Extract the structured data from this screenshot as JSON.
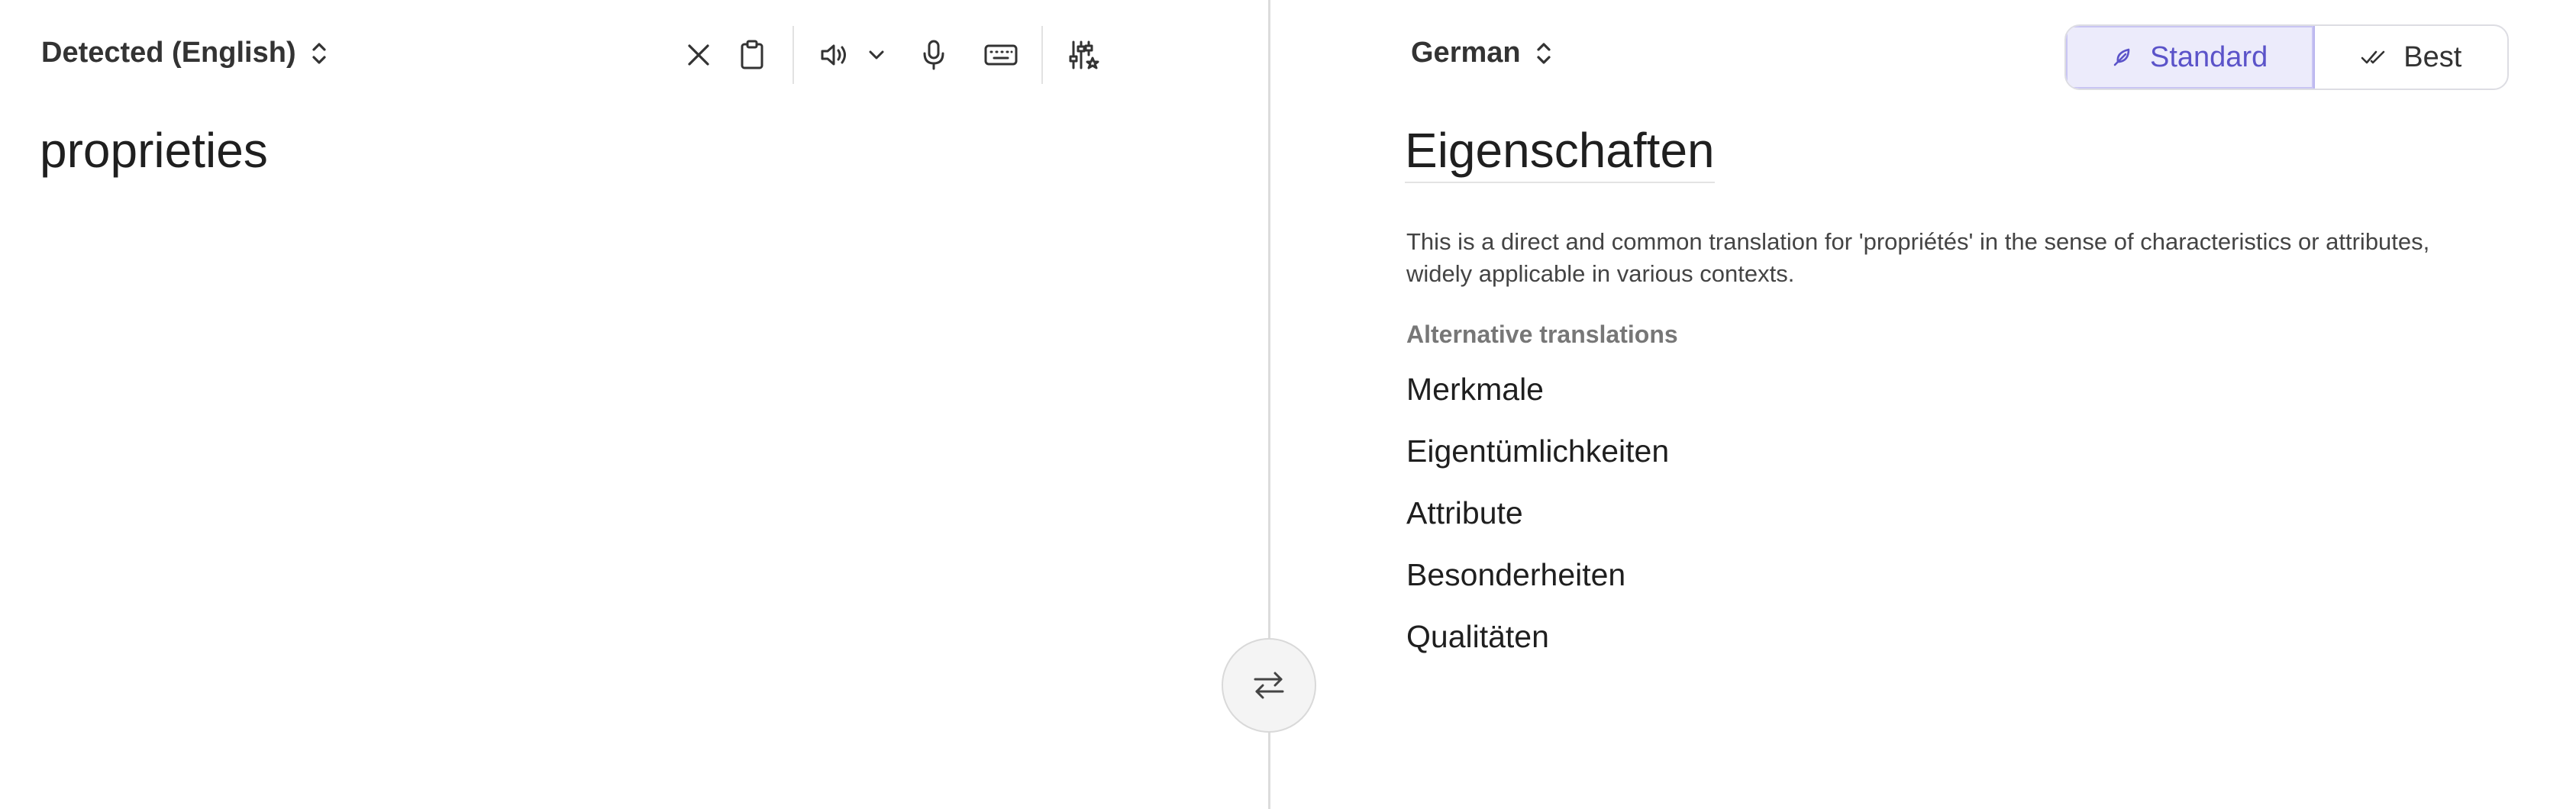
{
  "source": {
    "language": "Detected (English)",
    "text": "proprieties"
  },
  "target": {
    "language": "German",
    "translation": "Eigenschaften",
    "explanation": "This is a direct and common translation for 'propriétés' in the sense of characteristics or attributes, widely applicable in various contexts.",
    "alternatives_heading": "Alternative translations",
    "alternatives": [
      "Merkmale",
      "Eigentümlichkeiten",
      "Attribute",
      "Besonderheiten",
      "Qualitäten"
    ]
  },
  "modes": {
    "standard_label": "Standard",
    "best_label": "Best",
    "selected": "Standard"
  },
  "icons": {
    "clear": "close-icon",
    "clipboard": "clipboard-icon",
    "speaker": "speaker-icon",
    "speaker_menu": "chevron-down-icon",
    "microphone": "microphone-icon",
    "keyboard": "keyboard-icon",
    "settings": "sliders-icon",
    "swap": "swap-arrows-icon"
  },
  "colors": {
    "accent": "#5b53c9",
    "accent_bg": "#ecebfb"
  }
}
